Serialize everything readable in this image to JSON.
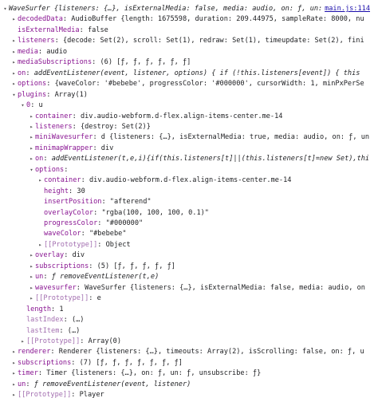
{
  "source_link": "main.js:114",
  "rows": [
    {
      "indent": 0,
      "toggle": "▾",
      "key": "",
      "sep": "",
      "value": "WaveSurfer {listeners: {…}, isExternalMedia: false, media: audio, on: ƒ, un: ƒ, …}",
      "italic": true,
      "dim": false
    },
    {
      "indent": 1,
      "toggle": "▸",
      "key": "decodedData",
      "sep": ": ",
      "value": "AudioBuffer {length: 1675598, duration: 209.44975, sampleRate: 8000, nu",
      "italic": false,
      "dim": false
    },
    {
      "indent": 1,
      "toggle": "",
      "key": "isExternalMedia",
      "sep": ": ",
      "value": "false",
      "italic": false,
      "dim": false
    },
    {
      "indent": 1,
      "toggle": "▸",
      "key": "listeners",
      "sep": ": ",
      "value": "{decode: Set(2), scroll: Set(1), redraw: Set(1), timeupdate: Set(2), fini",
      "italic": false,
      "dim": false
    },
    {
      "indent": 1,
      "toggle": "▸",
      "key": "media",
      "sep": ": ",
      "value": "audio",
      "italic": false,
      "dim": false
    },
    {
      "indent": 1,
      "toggle": "▸",
      "key": "mediaSubscriptions",
      "sep": ": ",
      "value": "(6) [ƒ, ƒ, ƒ, ƒ, ƒ, ƒ]",
      "italic": false,
      "dim": false
    },
    {
      "indent": 1,
      "toggle": "▸",
      "key": "on",
      "sep": ": ",
      "value": "addEventListener(event, listener, options) { if (!this.listeners[event]) { this",
      "italic": true,
      "dim": false
    },
    {
      "indent": 1,
      "toggle": "▸",
      "key": "options",
      "sep": ": ",
      "value": "{waveColor: '#bebebe', progressColor: '#000000', cursorWidth: 1, minPxPerSe",
      "italic": false,
      "dim": false
    },
    {
      "indent": 1,
      "toggle": "▾",
      "key": "plugins",
      "sep": ": ",
      "value": "Array(1)",
      "italic": false,
      "dim": false
    },
    {
      "indent": 2,
      "toggle": "▾",
      "key": "0",
      "sep": ": ",
      "value": "u",
      "italic": false,
      "dim": false
    },
    {
      "indent": 3,
      "toggle": "▸",
      "key": "container",
      "sep": ": ",
      "value": "div.audio-webform.d-flex.align-items-center.me-14",
      "italic": false,
      "dim": false
    },
    {
      "indent": 3,
      "toggle": "▸",
      "key": "listeners",
      "sep": ": ",
      "value": "{destroy: Set(2)}",
      "italic": false,
      "dim": false
    },
    {
      "indent": 3,
      "toggle": "▸",
      "key": "miniWavesurfer",
      "sep": ": ",
      "value": "d {listeners: {…}, isExternalMedia: true, media: audio, on: ƒ, un",
      "italic": false,
      "dim": false
    },
    {
      "indent": 3,
      "toggle": "▸",
      "key": "minimapWrapper",
      "sep": ": ",
      "value": "div",
      "italic": false,
      "dim": false
    },
    {
      "indent": 3,
      "toggle": "▸",
      "key": "on",
      "sep": ": ",
      "value": "addEventListener(t,e,i){if(this.listeners[t]||(this.listeners[t]=new Set),thi",
      "italic": true,
      "dim": false
    },
    {
      "indent": 3,
      "toggle": "▾",
      "key": "options",
      "sep": ":",
      "value": "",
      "italic": false,
      "dim": false
    },
    {
      "indent": 4,
      "toggle": "▸",
      "key": "container",
      "sep": ": ",
      "value": "div.audio-webform.d-flex.align-items-center.me-14",
      "italic": false,
      "dim": false
    },
    {
      "indent": 4,
      "toggle": "",
      "key": "height",
      "sep": ": ",
      "value": "30",
      "italic": false,
      "dim": false
    },
    {
      "indent": 4,
      "toggle": "",
      "key": "insertPosition",
      "sep": ": ",
      "value": "\"afterend\"",
      "italic": false,
      "dim": false
    },
    {
      "indent": 4,
      "toggle": "",
      "key": "overlayColor",
      "sep": ": ",
      "value": "\"rgba(100, 100, 100, 0.1)\"",
      "italic": false,
      "dim": false
    },
    {
      "indent": 4,
      "toggle": "",
      "key": "progressColor",
      "sep": ": ",
      "value": "\"#000000\"",
      "italic": false,
      "dim": false
    },
    {
      "indent": 4,
      "toggle": "",
      "key": "waveColor",
      "sep": ": ",
      "value": "\"#bebebe\"",
      "italic": false,
      "dim": false
    },
    {
      "indent": 4,
      "toggle": "▸",
      "key": "[[Prototype]]",
      "sep": ": ",
      "value": "Object",
      "italic": false,
      "dim": true
    },
    {
      "indent": 3,
      "toggle": "▸",
      "key": "overlay",
      "sep": ": ",
      "value": "div",
      "italic": false,
      "dim": false
    },
    {
      "indent": 3,
      "toggle": "▸",
      "key": "subscriptions",
      "sep": ": ",
      "value": "(5) [ƒ, ƒ, ƒ, ƒ, ƒ]",
      "italic": false,
      "dim": false
    },
    {
      "indent": 3,
      "toggle": "▸",
      "key": "un",
      "sep": ": ",
      "value": "ƒ removeEventListener(t,e)",
      "italic": true,
      "dim": false
    },
    {
      "indent": 3,
      "toggle": "▸",
      "key": "wavesurfer",
      "sep": ": ",
      "value": "WaveSurfer {listeners: {…}, isExternalMedia: false, media: audio, on",
      "italic": false,
      "dim": false
    },
    {
      "indent": 3,
      "toggle": "▸",
      "key": "[[Prototype]]",
      "sep": ": ",
      "value": "e",
      "italic": false,
      "dim": true
    },
    {
      "indent": 2,
      "toggle": "",
      "key": "length",
      "sep": ": ",
      "value": "1",
      "italic": false,
      "dim": false
    },
    {
      "indent": 2,
      "toggle": "",
      "key": "lastIndex",
      "sep": ": ",
      "value": "(…)",
      "italic": false,
      "dim": true
    },
    {
      "indent": 2,
      "toggle": "",
      "key": "lastItem",
      "sep": ": ",
      "value": "(…)",
      "italic": false,
      "dim": true
    },
    {
      "indent": 2,
      "toggle": "▸",
      "key": "[[Prototype]]",
      "sep": ": ",
      "value": "Array(0)",
      "italic": false,
      "dim": true
    },
    {
      "indent": 1,
      "toggle": "▸",
      "key": "renderer",
      "sep": ": ",
      "value": "Renderer {listeners: {…}, timeouts: Array(2), isScrolling: false, on: ƒ, u",
      "italic": false,
      "dim": false
    },
    {
      "indent": 1,
      "toggle": "▸",
      "key": "subscriptions",
      "sep": ": ",
      "value": "(7) [ƒ, ƒ, ƒ, ƒ, ƒ, ƒ, ƒ]",
      "italic": false,
      "dim": false
    },
    {
      "indent": 1,
      "toggle": "▸",
      "key": "timer",
      "sep": ": ",
      "value": "Timer {listeners: {…}, on: ƒ, un: ƒ, unsubscribe: ƒ}",
      "italic": false,
      "dim": false
    },
    {
      "indent": 1,
      "toggle": "▸",
      "key": "un",
      "sep": ": ",
      "value": "ƒ removeEventListener(event, listener)",
      "italic": true,
      "dim": false
    },
    {
      "indent": 1,
      "toggle": "▸",
      "key": "[[Prototype]]",
      "sep": ": ",
      "value": "Player",
      "italic": false,
      "dim": true
    }
  ]
}
